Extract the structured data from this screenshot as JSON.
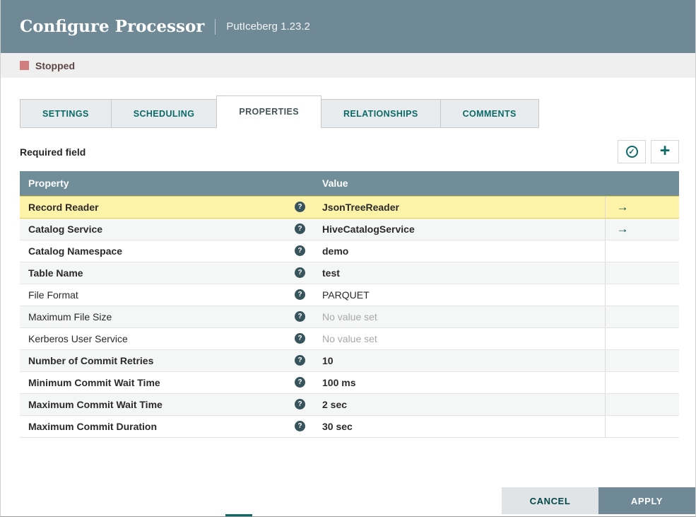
{
  "dialog": {
    "title": "Configure Processor",
    "subtitle": "PutIceberg 1.23.2"
  },
  "status": {
    "label": "Stopped"
  },
  "tabs": [
    {
      "label": "SETTINGS",
      "active": false
    },
    {
      "label": "SCHEDULING",
      "active": false
    },
    {
      "label": "PROPERTIES",
      "active": true
    },
    {
      "label": "RELATIONSHIPS",
      "active": false
    },
    {
      "label": "COMMENTS",
      "active": false
    }
  ],
  "toolbar": {
    "required_field_label": "Required field"
  },
  "icons": {
    "check": "✓",
    "plus": "+",
    "help": "?",
    "goto_arrow": "→"
  },
  "table": {
    "headers": {
      "property": "Property",
      "value": "Value"
    },
    "rows": [
      {
        "property": "Record Reader",
        "value": "JsonTreeReader",
        "bold": true,
        "no_value": false,
        "highlighted": true,
        "has_goto": true
      },
      {
        "property": "Catalog Service",
        "value": "HiveCatalogService",
        "bold": true,
        "no_value": false,
        "highlighted": false,
        "has_goto": true
      },
      {
        "property": "Catalog Namespace",
        "value": "demo",
        "bold": true,
        "no_value": false,
        "highlighted": false,
        "has_goto": false
      },
      {
        "property": "Table Name",
        "value": "test",
        "bold": true,
        "no_value": false,
        "highlighted": false,
        "has_goto": false
      },
      {
        "property": "File Format",
        "value": "PARQUET",
        "bold": false,
        "no_value": false,
        "highlighted": false,
        "has_goto": false
      },
      {
        "property": "Maximum File Size",
        "value": "No value set",
        "bold": false,
        "no_value": true,
        "highlighted": false,
        "has_goto": false
      },
      {
        "property": "Kerberos User Service",
        "value": "No value set",
        "bold": false,
        "no_value": true,
        "highlighted": false,
        "has_goto": false
      },
      {
        "property": "Number of Commit Retries",
        "value": "10",
        "bold": true,
        "no_value": false,
        "highlighted": false,
        "has_goto": false
      },
      {
        "property": "Minimum Commit Wait Time",
        "value": "100 ms",
        "bold": true,
        "no_value": false,
        "highlighted": false,
        "has_goto": false
      },
      {
        "property": "Maximum Commit Wait Time",
        "value": "2 sec",
        "bold": true,
        "no_value": false,
        "highlighted": false,
        "has_goto": false
      },
      {
        "property": "Maximum Commit Duration",
        "value": "30 sec",
        "bold": true,
        "no_value": false,
        "highlighted": false,
        "has_goto": false
      }
    ]
  },
  "footer": {
    "cancel_label": "CANCEL",
    "apply_label": "APPLY"
  },
  "colors": {
    "header_bg": "#6f8a96",
    "table_header_bg": "#708e9a",
    "accent_teal": "#0b6a68",
    "teal_dark": "#004849",
    "stopped_red": "#d07d7d",
    "highlight_yellow": "#fff3a9",
    "apply_bg": "#6f8a96"
  }
}
